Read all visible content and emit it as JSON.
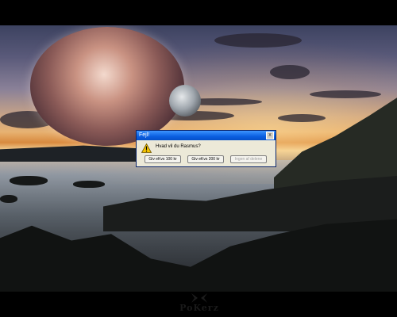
{
  "dialog": {
    "title": "Fejl!",
    "close_glyph": "x",
    "icon": "warning-icon",
    "message": "Hvad vil du Rasmus?",
    "buttons": [
      {
        "label": "Giv eKvs 100 kr",
        "enabled": true
      },
      {
        "label": "Giv eKvs 200 kr",
        "enabled": true
      },
      {
        "label": "Ingen af delene",
        "enabled": false
      }
    ]
  },
  "logo": {
    "text": "PoKerz"
  },
  "colors": {
    "titlebar": "#0a5ee0",
    "dialog_bg": "#ece9d8",
    "warning": "#f5c400"
  }
}
